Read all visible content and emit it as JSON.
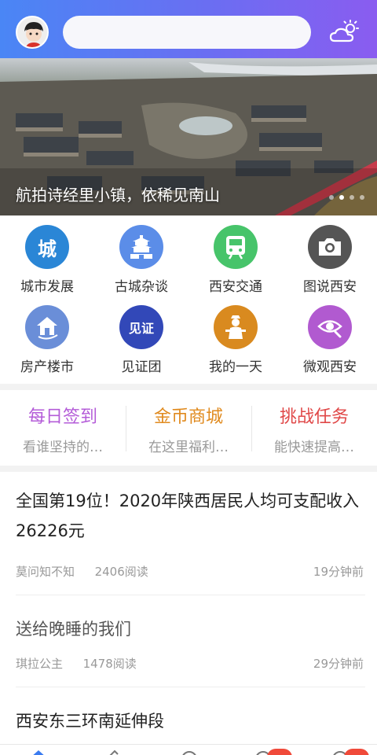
{
  "header": {
    "search_placeholder": "",
    "avatar_icon": "user-avatar-icon",
    "weather_icon": "cloud-sun-icon"
  },
  "banner": {
    "caption": "航拍诗经里小镇，依稀见南山",
    "slides": 4,
    "active_slide": 1
  },
  "grid": {
    "items": [
      {
        "label": "城市发展",
        "icon": "city-icon",
        "glyph": "城",
        "color": "#2a86d6"
      },
      {
        "label": "古城杂谈",
        "icon": "pagoda-icon",
        "color": "#5b8de8"
      },
      {
        "label": "西安交通",
        "icon": "train-icon",
        "color": "#47c46a"
      },
      {
        "label": "图说西安",
        "icon": "camera-icon",
        "color": "#555555"
      },
      {
        "label": "房产楼市",
        "icon": "house-icon",
        "color": "#6a8ed8"
      },
      {
        "label": "见证团",
        "icon": "witness-icon",
        "glyph": "见证",
        "color": "#3248b8"
      },
      {
        "label": "我的一天",
        "icon": "figure-icon",
        "color": "#d98a1f"
      },
      {
        "label": "微观西安",
        "icon": "eye-icon",
        "color": "#b15ad0"
      }
    ]
  },
  "tasks": [
    {
      "title": "每日签到",
      "subtitle": "看谁坚持的…",
      "color": "#b45cd8"
    },
    {
      "title": "金币商城",
      "subtitle": "在这里福利…",
      "color": "#e08a1e"
    },
    {
      "title": "挑战任务",
      "subtitle": "能快速提高…",
      "color": "#e04848"
    }
  ],
  "articles": [
    {
      "title": "全国第19位！2020年陕西居民人均可支配收入26226元",
      "author": "莫问知不知",
      "reads": "2406阅读",
      "time": "19分钟前"
    },
    {
      "title": "送给晚睡的我们",
      "author": "琪拉公主",
      "reads": "1478阅读",
      "time": "29分钟前"
    },
    {
      "title": "西安东三环南延伸段"
    }
  ],
  "colors": {
    "header_gradient_start": "#4a86f5",
    "header_gradient_end": "#8a5cf0",
    "badge": "#f04a3a"
  }
}
